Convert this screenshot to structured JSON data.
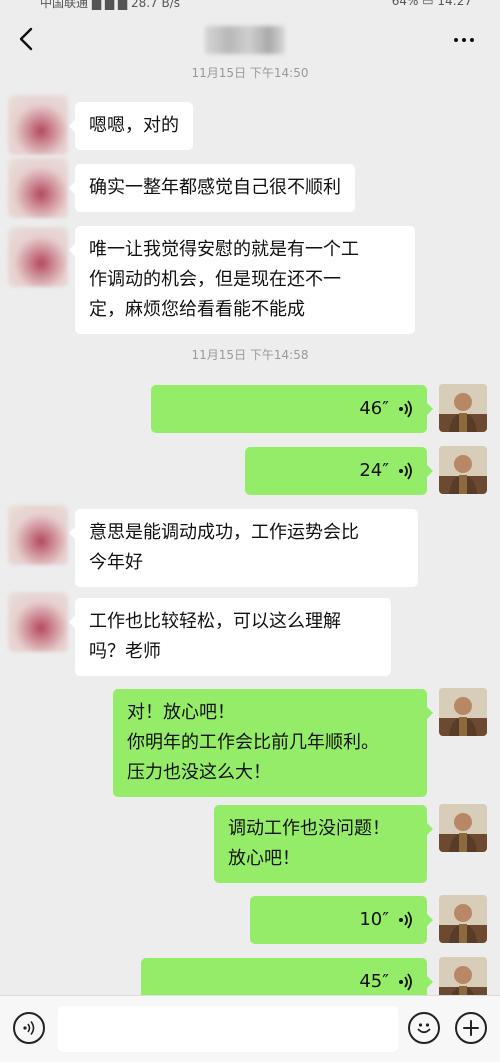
{
  "status_bar": {
    "left_text": "中国联通 ▆ ▆ ▆ 28.7 B/s",
    "right_text": "64% ▭ 14:27"
  },
  "chat": {
    "title": ""
  },
  "timestamps": [
    "11月15日 下午14:50",
    "11月15日 下午14:58"
  ],
  "messages": [
    {
      "side": "in",
      "type": "text",
      "text": "嗯嗯，对的"
    },
    {
      "side": "in",
      "type": "text",
      "text": "确实一整年都感觉自己很不顺利"
    },
    {
      "side": "in",
      "type": "text",
      "text": "唯一让我觉得安慰的就是有一个工\n作调动的机会，但是现在还不一\n定，麻烦您给看看能不能成"
    },
    {
      "side": "out",
      "type": "voice",
      "duration": "46″"
    },
    {
      "side": "out",
      "type": "voice",
      "duration": "24″"
    },
    {
      "side": "in",
      "type": "text",
      "text": "意思是能调动成功，工作运势会比\n今年好"
    },
    {
      "side": "in",
      "type": "text",
      "text": "工作也比较轻松，可以这么理解\n吗？老师"
    },
    {
      "side": "out",
      "type": "text",
      "text": "对！放心吧！\n你明年的工作会比前几年顺利。\n压力也没这么大！"
    },
    {
      "side": "out",
      "type": "text",
      "text": "调动工作也没问题！\n放心吧！"
    },
    {
      "side": "out",
      "type": "voice",
      "duration": "10″"
    },
    {
      "side": "out",
      "type": "voice",
      "duration": "45″"
    }
  ],
  "input": {
    "value": "",
    "placeholder": ""
  },
  "icons": {
    "back": "chevron-left-icon",
    "more": "more-dots-icon",
    "voice_toggle": "voice-icon",
    "emoji": "emoji-icon",
    "plus": "plus-icon",
    "voice_wave": "voice-wave-icon"
  },
  "colors": {
    "background": "#ededed",
    "incoming_bubble": "#ffffff",
    "outgoing_bubble": "#95ec69",
    "input_bar": "#f7f7f7"
  }
}
